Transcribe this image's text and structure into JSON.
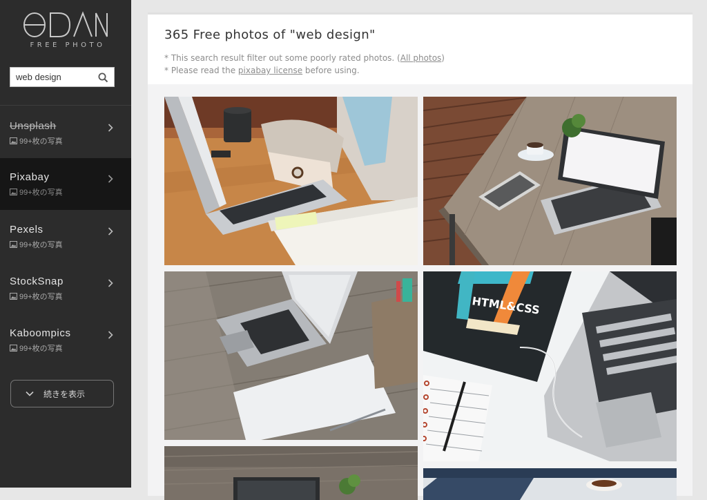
{
  "sidebar": {
    "logo": "ODAN",
    "logo_sub": "FREE PHOTO",
    "search_value": "web design",
    "sources": [
      {
        "name": "Unsplash",
        "count": "99+枚の写真"
      },
      {
        "name": "Pixabay",
        "count": "99+枚の写真"
      },
      {
        "name": "Pexels",
        "count": "99+枚の写真"
      },
      {
        "name": "StockSnap",
        "count": "99+枚の写真"
      },
      {
        "name": "Kaboompics",
        "count": "99+枚の写真"
      }
    ],
    "more_label": "続きを表示"
  },
  "main": {
    "title": "365 Free photos of \"web design\"",
    "note1_prefix": "* This search result filter out some poorly rated photos. (",
    "note1_link": "All photos",
    "note1_suffix": ")",
    "note2_prefix": "* Please read the ",
    "note2_link": "pixabay license",
    "note2_suffix": " before using.",
    "photos": [
      {
        "alt": "laptop-typing-photo"
      },
      {
        "alt": "laptop-wooden-table-photo"
      },
      {
        "alt": "laptop-notebook-photo"
      },
      {
        "alt": "html-css-book-laptop-photo"
      },
      {
        "alt": "laptop-plant-photo"
      },
      {
        "alt": "keyboard-coffee-photo"
      }
    ],
    "book_text": "HTML&CSS"
  },
  "colors": {
    "sidebar_bg": "#2c2c2c",
    "active_bg": "#161616",
    "page_bg": "#e7e7e7"
  }
}
